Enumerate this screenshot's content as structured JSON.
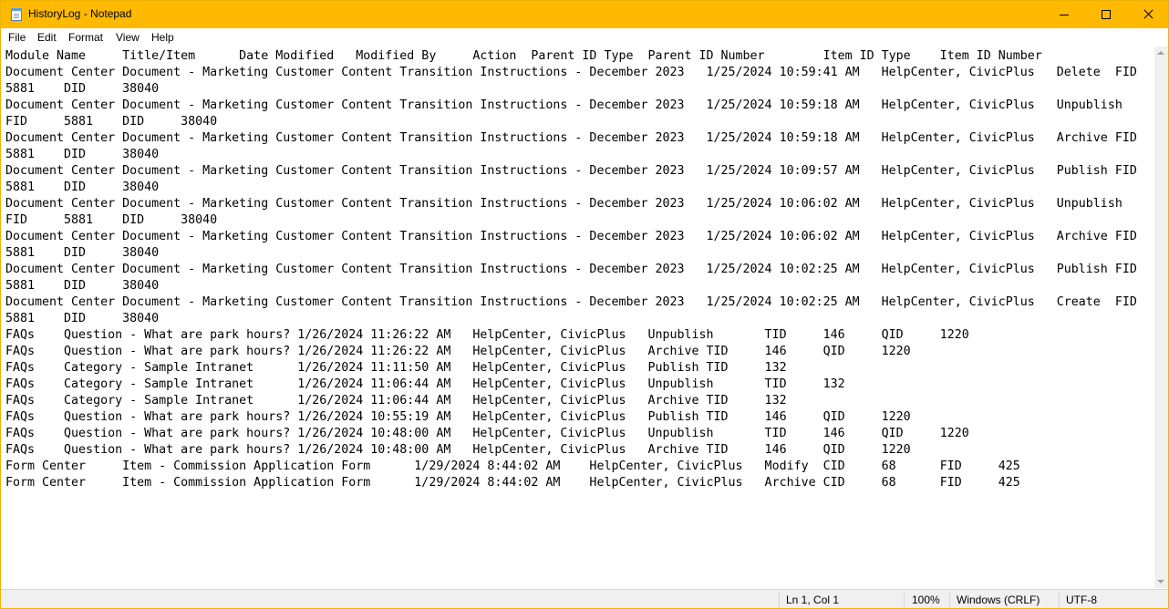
{
  "window": {
    "title": "HistoryLog - Notepad"
  },
  "menu": {
    "file": "File",
    "edit": "Edit",
    "format": "Format",
    "view": "View",
    "help": "Help"
  },
  "editor": {
    "lines": [
      "Module Name     Title/Item      Date Modified   Modified By     Action  Parent ID Type  Parent ID Number        Item ID Type    Item ID Number",
      "Document Center Document - Marketing Customer Content Transition Instructions - December 2023   1/25/2024 10:59:41 AM   HelpCenter, CivicPlus   Delete  FID",
      "5881    DID     38040",
      "Document Center Document - Marketing Customer Content Transition Instructions - December 2023   1/25/2024 10:59:18 AM   HelpCenter, CivicPlus   Unpublish",
      "FID     5881    DID     38040",
      "Document Center Document - Marketing Customer Content Transition Instructions - December 2023   1/25/2024 10:59:18 AM   HelpCenter, CivicPlus   Archive FID",
      "5881    DID     38040",
      "Document Center Document - Marketing Customer Content Transition Instructions - December 2023   1/25/2024 10:09:57 AM   HelpCenter, CivicPlus   Publish FID",
      "5881    DID     38040",
      "Document Center Document - Marketing Customer Content Transition Instructions - December 2023   1/25/2024 10:06:02 AM   HelpCenter, CivicPlus   Unpublish",
      "FID     5881    DID     38040",
      "Document Center Document - Marketing Customer Content Transition Instructions - December 2023   1/25/2024 10:06:02 AM   HelpCenter, CivicPlus   Archive FID",
      "5881    DID     38040",
      "Document Center Document - Marketing Customer Content Transition Instructions - December 2023   1/25/2024 10:02:25 AM   HelpCenter, CivicPlus   Publish FID",
      "5881    DID     38040",
      "Document Center Document - Marketing Customer Content Transition Instructions - December 2023   1/25/2024 10:02:25 AM   HelpCenter, CivicPlus   Create  FID",
      "5881    DID     38040",
      "FAQs    Question - What are park hours? 1/26/2024 11:26:22 AM   HelpCenter, CivicPlus   Unpublish       TID     146     QID     1220",
      "FAQs    Question - What are park hours? 1/26/2024 11:26:22 AM   HelpCenter, CivicPlus   Archive TID     146     QID     1220",
      "FAQs    Category - Sample Intranet      1/26/2024 11:11:50 AM   HelpCenter, CivicPlus   Publish TID     132",
      "FAQs    Category - Sample Intranet      1/26/2024 11:06:44 AM   HelpCenter, CivicPlus   Unpublish       TID     132",
      "FAQs    Category - Sample Intranet      1/26/2024 11:06:44 AM   HelpCenter, CivicPlus   Archive TID     132",
      "FAQs    Question - What are park hours? 1/26/2024 10:55:19 AM   HelpCenter, CivicPlus   Publish TID     146     QID     1220",
      "FAQs    Question - What are park hours? 1/26/2024 10:48:00 AM   HelpCenter, CivicPlus   Unpublish       TID     146     QID     1220",
      "FAQs    Question - What are park hours? 1/26/2024 10:48:00 AM   HelpCenter, CivicPlus   Archive TID     146     QID     1220",
      "Form Center     Item - Commission Application Form      1/29/2024 8:44:02 AM    HelpCenter, CivicPlus   Modify  CID     68      FID     425",
      "Form Center     Item - Commission Application Form      1/29/2024 8:44:02 AM    HelpCenter, CivicPlus   Archive CID     68      FID     425"
    ]
  },
  "status": {
    "position": "Ln 1, Col 1",
    "zoom": "100%",
    "line_ending": "Windows (CRLF)",
    "encoding": "UTF-8"
  },
  "colors": {
    "titlebar": "#ffb900",
    "background": "#ffffff",
    "statusbar": "#f0f0f0"
  },
  "icons": {
    "app": "notepad-icon",
    "minimize": "minimize-icon",
    "maximize": "maximize-icon",
    "close": "close-icon"
  }
}
